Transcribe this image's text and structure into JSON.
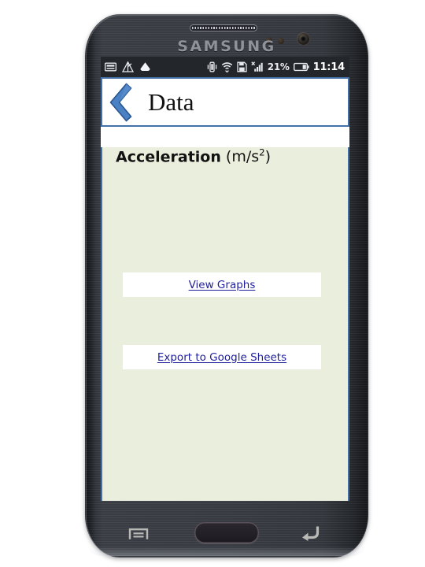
{
  "device": {
    "brand_label": "SAMSUNG",
    "speaker_icon": "speaker-grille",
    "front_camera_icon": "front-camera",
    "proximity_sensor_icon": "proximity-sensor",
    "light_sensor_icon": "light-sensor",
    "home_button_label": "",
    "menu_key_icon": "menu-icon",
    "back_key_icon": "back-arrow-icon"
  },
  "status_bar": {
    "left_icons": [
      {
        "name": "keyboard-icon",
        "label": "keyboard"
      },
      {
        "name": "warning-triangle-icon",
        "label": "alert"
      },
      {
        "name": "google-drive-icon",
        "label": "drive"
      }
    ],
    "right_icons": [
      {
        "name": "vibrate-icon",
        "label": "vibrate"
      },
      {
        "name": "wifi-icon",
        "label": "wi-fi"
      },
      {
        "name": "sd-card-icon",
        "label": "storage"
      },
      {
        "name": "cellular-signal-muted-icon",
        "label": "no signal"
      },
      {
        "name": "battery-icon",
        "label": "battery"
      }
    ],
    "battery_percent": "21%",
    "clock": "11:14"
  },
  "app_header": {
    "back_icon": "back-chevron-icon",
    "title": "Data",
    "accent_color": "#4472a8"
  },
  "main": {
    "background_color": "#eaeedd",
    "section": {
      "title_strong": "Acceleration",
      "title_unit_prefix": " (m/s",
      "title_unit_exponent": "2",
      "title_unit_suffix": ")"
    },
    "actions": [
      {
        "name": "view-graphs",
        "label": "View Graphs",
        "link_color": "#1f1f9c"
      },
      {
        "name": "export-to-google-sheets",
        "label": "Export to Google Sheets",
        "link_color": "#1f1f9c"
      }
    ]
  }
}
